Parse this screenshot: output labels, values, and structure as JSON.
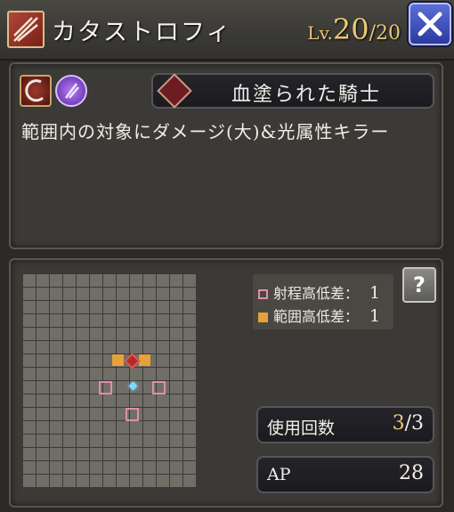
{
  "header": {
    "title": "カタストロフィ",
    "level_label": "Lv.",
    "level_current": "20",
    "level_max": "/20",
    "skill_icon": "sword-slash-icon",
    "close_icon": "close-x-icon"
  },
  "skill": {
    "element_icons": [
      "slash-attack-icon",
      "dark-element-icon"
    ],
    "title_icon": "blood-knight-icon",
    "title": "血塗られた騎士",
    "description": "範囲内の対象にダメージ(大)&光属性キラー"
  },
  "range_map": {
    "columns": 13,
    "rows": 16,
    "legend": [
      {
        "label": "射程高低差：",
        "value": "1",
        "color": "#df8db0"
      },
      {
        "label": "範囲高低差：",
        "value": "1",
        "color": "#e6a13a"
      }
    ],
    "help_label": "?"
  },
  "stats": {
    "uses_label": "使用回数",
    "uses_current": "3",
    "uses_max": "/3",
    "ap_label": "AP",
    "ap_value": "28"
  },
  "colors": {
    "accent_gold": "#e9c876",
    "range_orange": "#e6a13a",
    "target_pink": "#df8db0",
    "close_blue": "#3a4bd0"
  }
}
